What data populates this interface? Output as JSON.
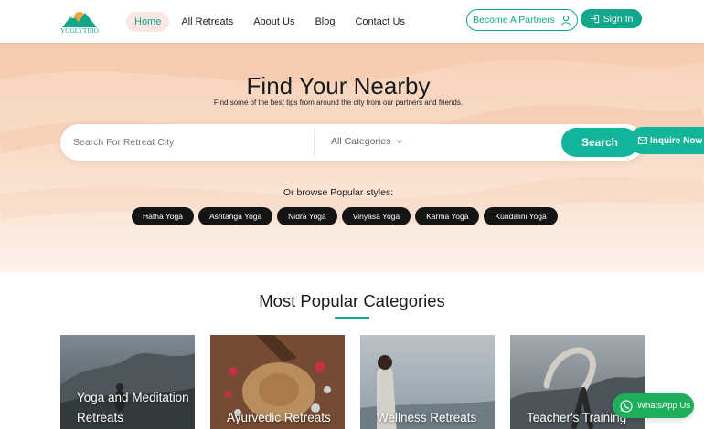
{
  "header": {
    "logo_text": "YOGLYTIBO",
    "nav": [
      {
        "label": "Home",
        "active": true
      },
      {
        "label": "All Retreats",
        "active": false
      },
      {
        "label": "About Us",
        "active": false
      },
      {
        "label": "Blog",
        "active": false
      },
      {
        "label": "Contact Us",
        "active": false
      }
    ],
    "partner_label": "Become A Partners",
    "signin_label": "Sign In"
  },
  "hero": {
    "title": "Find Your Nearby",
    "subtitle": "Find some of the best tips from around the city from our partners and friends.",
    "search_placeholder": "Search For Retreat City",
    "search_value": "",
    "category_selected": "All Categories",
    "search_button": "Search",
    "inquire_label": "Inquire Now",
    "browse_label": "Or browse Popular styles:",
    "styles": [
      "Hatha Yoga",
      "Ashtanga Yoga",
      "Nidra Yoga",
      "Vinyasa Yoga",
      "Karma Yoga",
      "Kundalini Yoga"
    ]
  },
  "categories": {
    "title": "Most Popular Categories",
    "items": [
      {
        "label": "Yoga and Meditation Retreats"
      },
      {
        "label": "Ayurvedic Retreats"
      },
      {
        "label": "Wellness Retreats"
      },
      {
        "label": "Teacher's Training"
      }
    ]
  },
  "whatsapp_label": "WhatsApp Us",
  "colors": {
    "accent": "#13a68b",
    "button_green": "#13b59a",
    "whatsapp": "#1eae5c",
    "pill_dark": "#141414"
  },
  "icons": {
    "partner": "person-outline-icon",
    "signin": "sign-in-arrow-icon",
    "category_chevron": "chevron-down-icon",
    "inquire": "envelope-icon",
    "whatsapp": "whatsapp-icon"
  }
}
